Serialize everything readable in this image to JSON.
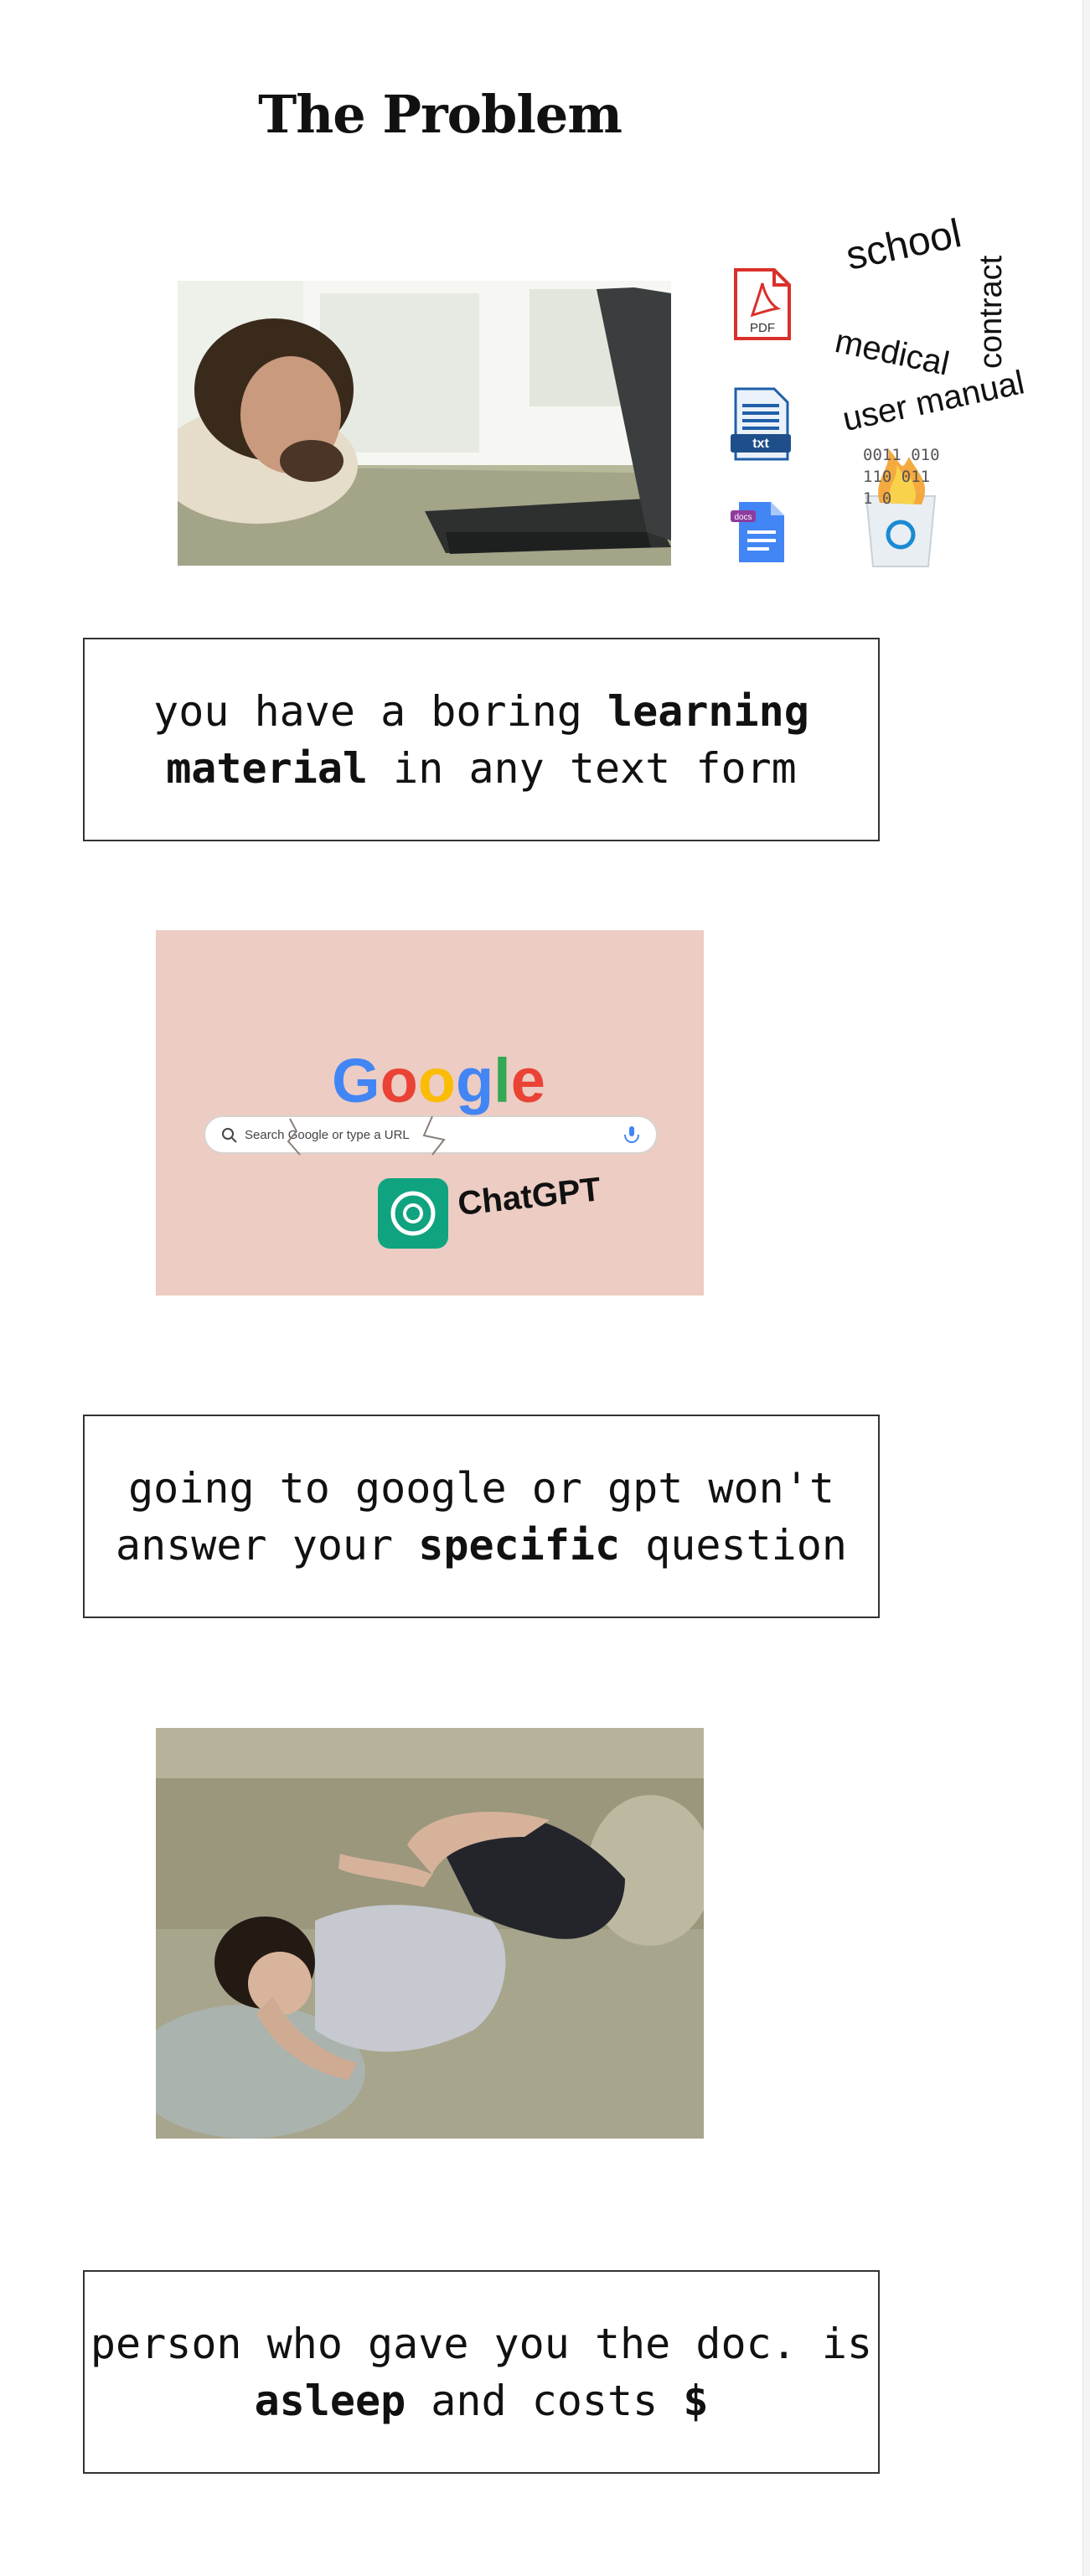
{
  "heading": "The Problem",
  "file_icons": {
    "pdf_label": "PDF",
    "txt_label": "txt",
    "docs_label": "docs"
  },
  "doc_words": {
    "school": "school",
    "contract": "contract",
    "medical": "medical",
    "user_manual": "user manual",
    "binary_row_1": "0011 010",
    "binary_row_2": "110 011",
    "binary_row_3": "1 0"
  },
  "section_1": {
    "caption_pre": "you have a boring ",
    "caption_bold": "learning material",
    "caption_post": " in any text form"
  },
  "search_image": {
    "logo_text": "Google",
    "search_placeholder": "Search Google or type a URL",
    "chatgpt_label": "ChatGPT"
  },
  "section_2": {
    "caption_pre": "going to google or gpt won't answer your ",
    "caption_bold": "specific",
    "caption_post": " question"
  },
  "section_3": {
    "caption_pre": "person who gave you the doc. is ",
    "caption_bold": "asleep",
    "caption_mid": " and costs ",
    "caption_bold_2": "$"
  },
  "colors": {
    "pdf_red": "#d9302a",
    "txt_blue": "#1f5fa8",
    "docs_blue": "#4285f4",
    "chatgpt_green": "#10a37f",
    "pink_background": "#ecccc3"
  }
}
